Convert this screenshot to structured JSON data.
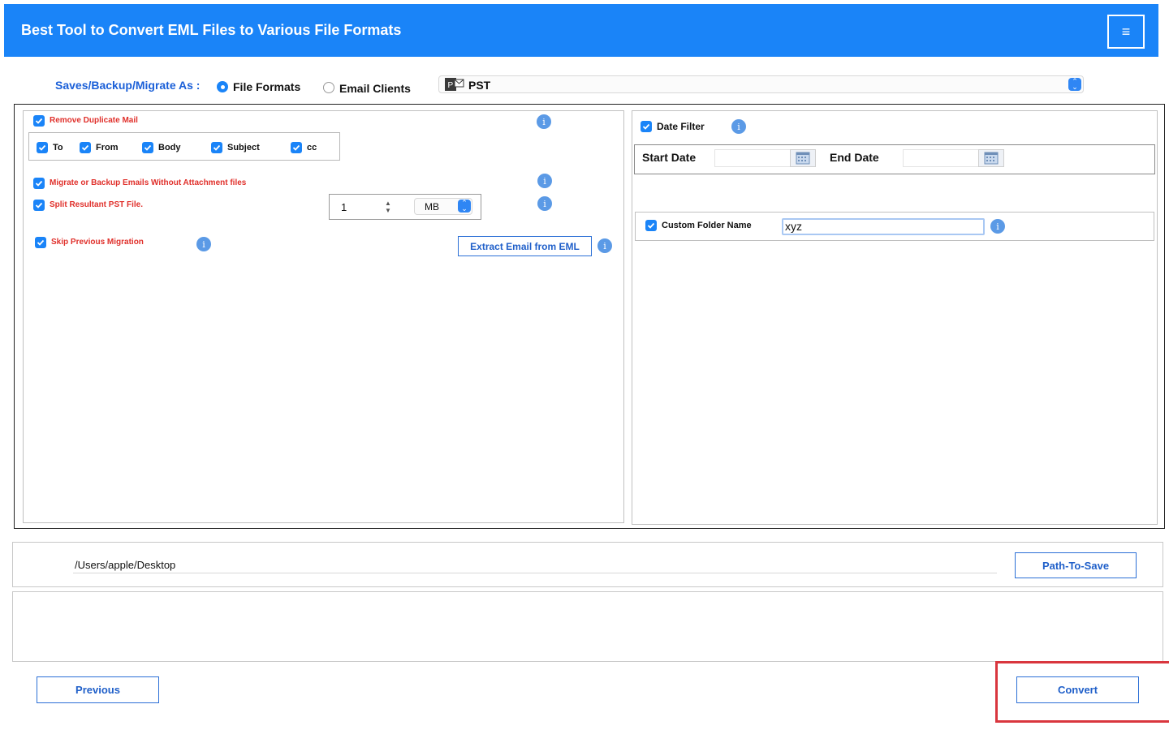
{
  "header": {
    "title": "Best Tool to Convert EML Files to Various File Formats",
    "menu_icon": "hamburger-menu-icon"
  },
  "save_as": {
    "label": "Saves/Backup/Migrate As :",
    "options": [
      {
        "label": "File Formats",
        "selected": true
      },
      {
        "label": "Email Clients",
        "selected": false
      }
    ],
    "format_value": "PST"
  },
  "left": {
    "remove_duplicate": {
      "label": "Remove Duplicate Mail",
      "checked": true
    },
    "fields": [
      {
        "label": "To",
        "checked": true
      },
      {
        "label": "From",
        "checked": true
      },
      {
        "label": "Body",
        "checked": true
      },
      {
        "label": "Subject",
        "checked": true
      },
      {
        "label": "cc",
        "checked": true
      }
    ],
    "without_attachment": {
      "label": "Migrate or Backup Emails Without Attachment files",
      "checked": true
    },
    "split": {
      "label": "Split Resultant PST File.",
      "checked": true,
      "size": "1",
      "unit": "MB"
    },
    "skip_previous": {
      "label": "Skip Previous Migration",
      "checked": true
    },
    "extract_button": "Extract Email from EML",
    "info_glyph": "i"
  },
  "right": {
    "date_filter": {
      "label": "Date Filter",
      "checked": true
    },
    "start_date_label": "Start Date",
    "start_date_value": "",
    "end_date_label": "End Date",
    "end_date_value": "",
    "custom_folder": {
      "label": "Custom Folder Name",
      "checked": true,
      "value": "xyz"
    }
  },
  "path": {
    "value": "/Users/apple/Desktop",
    "button": "Path-To-Save"
  },
  "footer": {
    "previous": "Previous",
    "convert": "Convert"
  },
  "colors": {
    "header": "#1a84f8",
    "accent": "#1a84f8",
    "warning_text": "#e0302b",
    "highlight": "#d9363e"
  }
}
